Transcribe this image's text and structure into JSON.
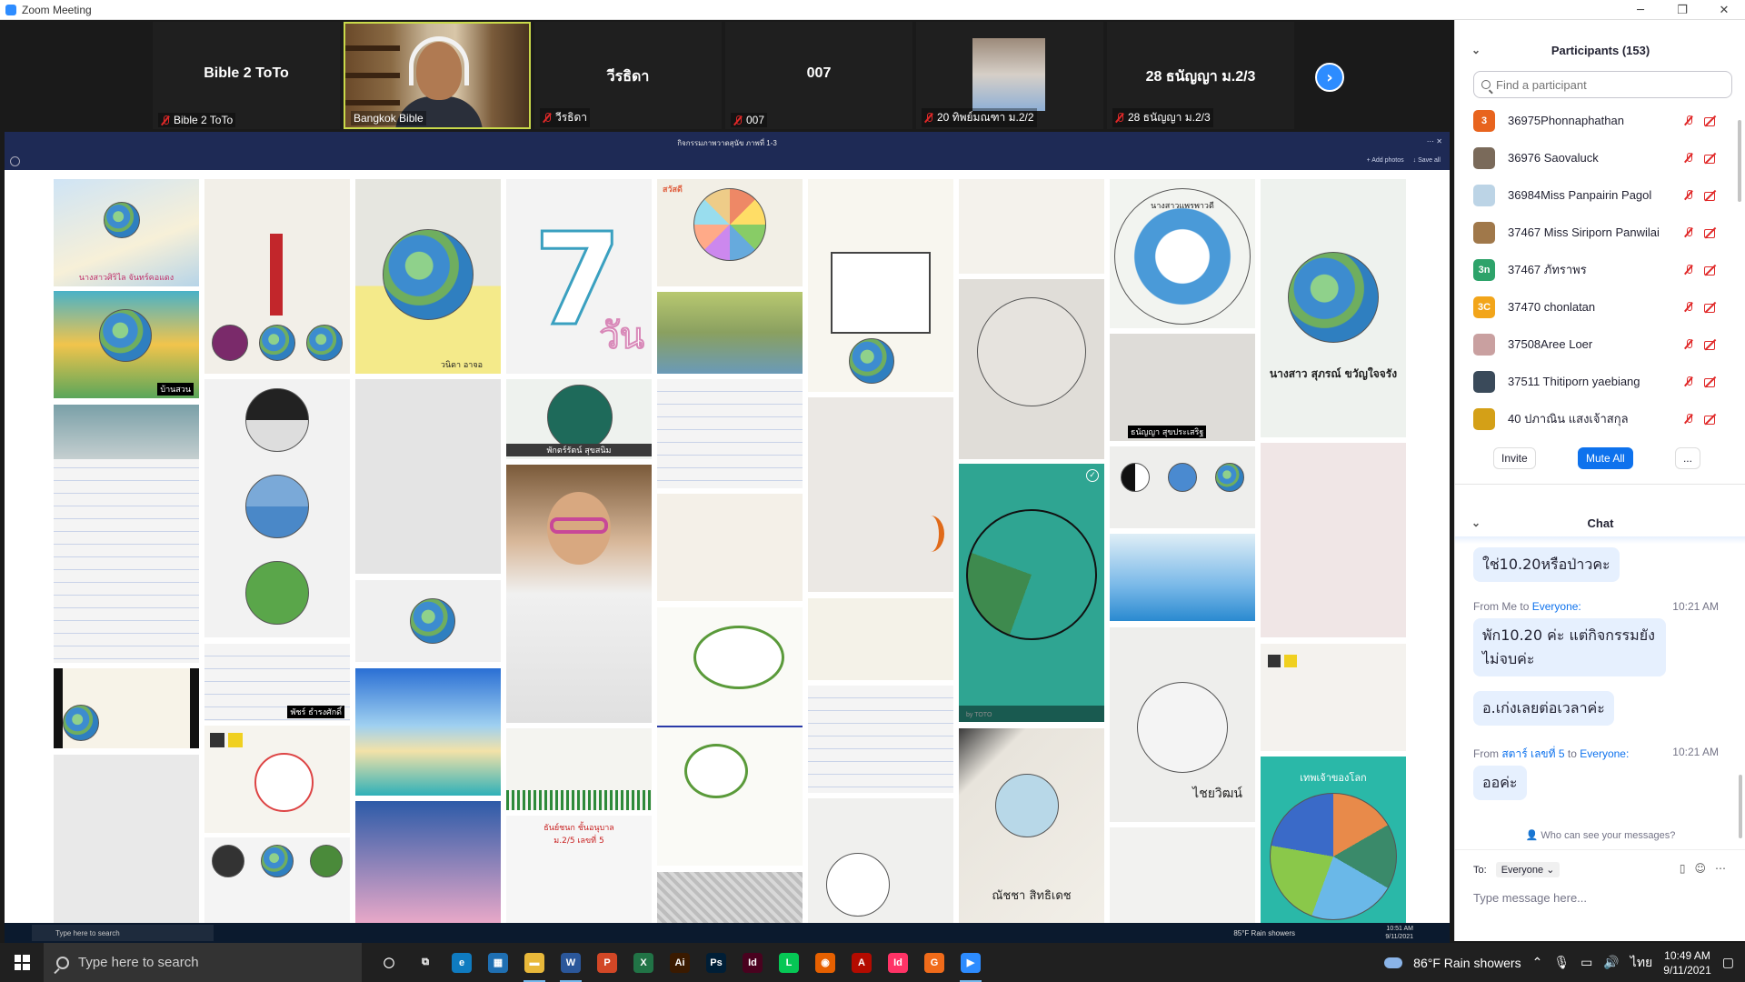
{
  "window": {
    "title": "Zoom Meeting",
    "controls": [
      "─",
      "❐",
      "✕"
    ]
  },
  "strip": {
    "tiles": [
      {
        "big_name": "Bible 2 ToTo",
        "label": "Bible 2 ToTo"
      },
      {
        "big_name": "",
        "label": "Bangkok Bible"
      },
      {
        "big_name": "วีรธิดา",
        "label": "วีรธิดา"
      },
      {
        "big_name": "007",
        "label": "007"
      },
      {
        "big_name": "",
        "label": "20 ทิพย์มณฑา ม.2/2"
      },
      {
        "big_name": "28 ธนัญญา ม.2/3",
        "label": "28 ธนัญญา ม.2/3"
      }
    ],
    "next_icon": "chevron-right-icon",
    "next_glyph": "›"
  },
  "share": {
    "title": "กิจกรรมภาพวาดสุนัข ภาพที่ 1-3",
    "actions": [
      "+ Add photos",
      "↓ Save all"
    ],
    "top_icons": "⋯ ✕",
    "photo_captions": {
      "p1": "นางสาวศิริไล จันทร์คอแดง",
      "p2": "บ้านสวน",
      "p4": "วนิดา อาจอ",
      "p5": "วัน",
      "p6": "สวัสดี",
      "p7": "พัชร์ ธำรงศักดิ์",
      "p8": "พักตร์รัตน์ สุขสนิม",
      "p9": "นางสาว สุภรณ์ ขวัญใจจรัง",
      "p10": "ธนัญญา สุขประเสริฐ",
      "p11": "นางสาวแพรพาวดี",
      "p12": "ไชยวิฒน์",
      "p13": "ณัชชา สิทธิเดช",
      "p14": "ธันย์ชนก ชั้นอนุบาล",
      "p15": "ม.2/5 เลขที่ 5",
      "p16": "เทพเจ้าของโลก",
      "p17": "by TOTO"
    }
  },
  "inner_taskbar": {
    "search": "Type here to search",
    "weather": "85°F  Rain showers",
    "time": "10:51 AM",
    "date": "9/11/2021"
  },
  "participants": {
    "title": "Participants (153)",
    "search_placeholder": "Find a participant",
    "list": [
      {
        "name": "36975Phonnaphathan",
        "avatar": "3",
        "color": "#e8641e"
      },
      {
        "name": "36976 Saovaluck",
        "avatar": "",
        "color": "#7a6a5a"
      },
      {
        "name": "36984Miss Panpairin Pagol",
        "avatar": "",
        "color": "#bcd4e6"
      },
      {
        "name": "37467 Miss Siriporn Panwilai",
        "avatar": "",
        "color": "#a0784a"
      },
      {
        "name": "37467 ภัทราพร",
        "avatar": "3n",
        "color": "#2da36a"
      },
      {
        "name": "37470 chonlatan",
        "avatar": "3C",
        "color": "#f2a51a"
      },
      {
        "name": "37508Aree Loer",
        "avatar": "",
        "color": "#c9a0a0"
      },
      {
        "name": "37511 Thitiporn yaebiang",
        "avatar": "",
        "color": "#3a4a5a"
      },
      {
        "name": "40 ปภาณิน แสงเจ้าสกุล",
        "avatar": "",
        "color": "#d4a017"
      }
    ],
    "invite": "Invite",
    "mute_all": "Mute All",
    "more": "..."
  },
  "chat": {
    "title": "Chat",
    "messages": [
      {
        "text": "ใช่10.20หรือป่าวคะ"
      },
      {
        "from_prefix": "From",
        "sender": "Me",
        "to_word": "to",
        "recipient": "Everyone:",
        "time": "10:21 AM",
        "text": "พัก10.20 ค่ะ แต่กิจกรรมยังไม่จบค่ะ"
      },
      {
        "text": "อ.เก่งเลยต่อเวลาค่ะ"
      },
      {
        "from_prefix": "From",
        "sender": "สตาร์ เลขที่ 5",
        "to_word": "to",
        "recipient": "Everyone:",
        "time": "10:21 AM",
        "text": "ออค่ะ"
      }
    ],
    "who_can_see": "Who can see your messages?",
    "to_label": "To:",
    "to_value": "Everyone",
    "placeholder": "Type message here..."
  },
  "taskbar": {
    "search": "Type here to search",
    "apps": [
      {
        "name": "cortana-icon",
        "glyph": "◯",
        "color": "transparent"
      },
      {
        "name": "task-view-icon",
        "glyph": "⧉",
        "color": "transparent"
      },
      {
        "name": "edge-icon",
        "glyph": "e",
        "color": "#0f7bc0"
      },
      {
        "name": "calculator-icon",
        "glyph": "▦",
        "color": "#1f6fb2"
      },
      {
        "name": "file-explorer-icon",
        "glyph": "▬",
        "color": "#e8b83a"
      },
      {
        "name": "word-icon",
        "glyph": "W",
        "color": "#2b579a"
      },
      {
        "name": "powerpoint-icon",
        "glyph": "P",
        "color": "#d24726"
      },
      {
        "name": "excel-icon",
        "glyph": "X",
        "color": "#217346"
      },
      {
        "name": "illustrator-icon",
        "glyph": "Ai",
        "color": "#3a1a00"
      },
      {
        "name": "photoshop-icon",
        "glyph": "Ps",
        "color": "#001e36"
      },
      {
        "name": "indesign-icon",
        "glyph": "Id",
        "color": "#49021f"
      },
      {
        "name": "line-icon",
        "glyph": "L",
        "color": "#06c755"
      },
      {
        "name": "firefox-icon",
        "glyph": "◉",
        "color": "#e66000"
      },
      {
        "name": "acrobat-icon",
        "glyph": "A",
        "color": "#b30b00"
      },
      {
        "name": "indesign2-icon",
        "glyph": "Id",
        "color": "#ff3366"
      },
      {
        "name": "grammarly-icon",
        "glyph": "G",
        "color": "#f06b1a"
      },
      {
        "name": "zoom-icon",
        "glyph": "▶",
        "color": "#2d8cff"
      }
    ],
    "weather": "86°F  Rain showers",
    "lang": "ไทย",
    "time": "10:49 AM",
    "date": "9/11/2021"
  }
}
